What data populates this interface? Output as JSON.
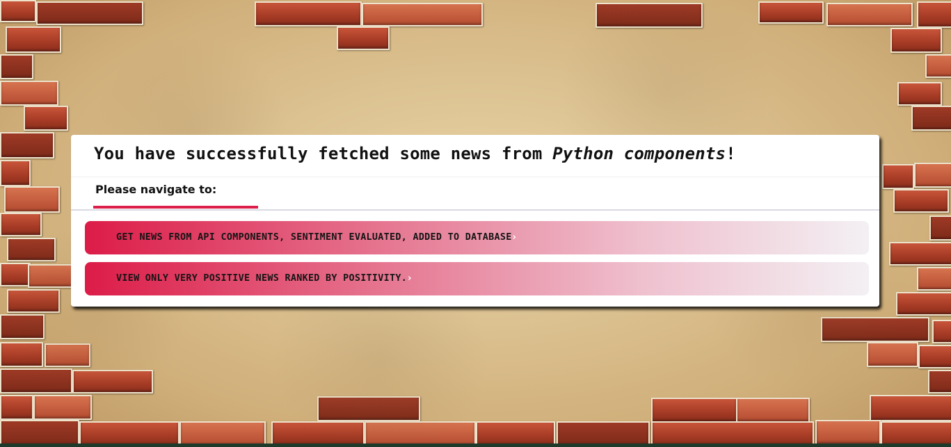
{
  "page": {
    "title_prefix": "You have successfully fetched some news from ",
    "title_emphasis": "Python components",
    "title_suffix": "!"
  },
  "nav": {
    "tab_label": "Please navigate to:"
  },
  "links": [
    {
      "label": "GET NEWS FROM API COMPONENTS, SENTIMENT EVALUATED, ADDED TO DATABASE",
      "icon": "chevron-right-icon",
      "chevron": "›"
    },
    {
      "label": "VIEW ONLY VERY POSITIVE NEWS RANKED BY POSITIVITY.",
      "icon": "chevron-right-icon",
      "chevron": "›"
    }
  ],
  "colors": {
    "accent": "#dc1f4a",
    "card_bg": "#ffffff"
  }
}
